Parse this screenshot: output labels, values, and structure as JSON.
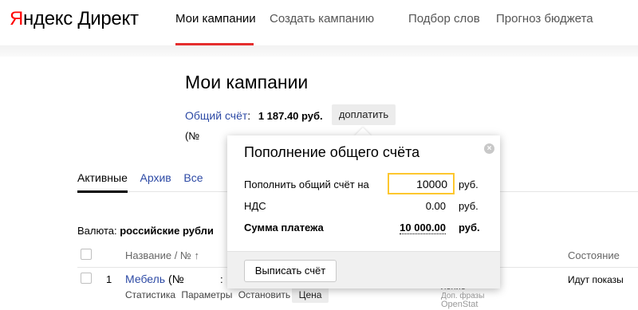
{
  "header": {
    "logo_ya": "Я",
    "logo_rest": "ндекс",
    "logo_product": "Директ",
    "nav": [
      "Мои кампании",
      "Создать кампанию",
      "Подбор слов",
      "Прогноз бюджета"
    ]
  },
  "page": {
    "title": "Мои кампании",
    "account_label": "Общий счёт",
    "account_sep": ":",
    "account_amount": "1 187.40 руб.",
    "topup_label": "доплатить",
    "paren_text": "(№"
  },
  "tabs": [
    "Активные",
    "Архив",
    "Все"
  ],
  "currency": {
    "label": "Валюта:",
    "value": "российские рубли"
  },
  "table": {
    "col_name": "Название / № ↑",
    "col_state": "Состояние",
    "rows": [
      {
        "index": "1",
        "name": "Мебель",
        "number": "(№",
        "mid": ":",
        "links": [
          "Статистика",
          "Параметры",
          "Остановить"
        ],
        "price_button": "Цена",
        "extra1": "ление",
        "extra2": "Доп. фразы",
        "extra3": "OpenStat",
        "state": "Идут показы"
      }
    ]
  },
  "popup": {
    "title": "Пополнение общего счёта",
    "close": "×",
    "topup_label": "Пополнить общий счёт на",
    "topup_value": "10000",
    "topup_unit": "руб.",
    "vat_label": "НДС",
    "vat_value": "0.00",
    "vat_unit": "руб.",
    "total_label": "Сумма платежа",
    "total_value": "10 000.00",
    "total_unit": "руб.",
    "invoice_button": "Выписать счёт"
  },
  "colors": {
    "accent_red": "#e52e2e",
    "link_blue": "#2d4aa5",
    "input_focus": "#fdc72e"
  }
}
